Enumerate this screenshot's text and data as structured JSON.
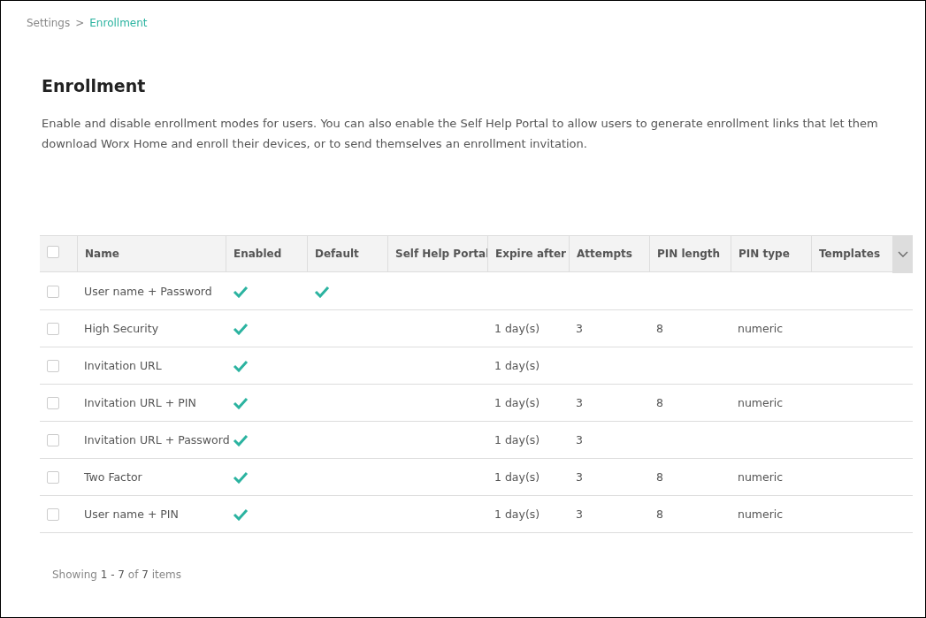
{
  "breadcrumb": [
    {
      "label": "Settings",
      "current": false
    },
    {
      "label": "Enrollment",
      "current": true
    }
  ],
  "breadcrumb_separator": ">",
  "title": "Enrollment",
  "description": "Enable and disable enrollment modes for users. You can also enable the Self Help Portal to allow users to generate enrollment links that let them download Worx Home and enroll their devices, or to send themselves an enrollment invitation.",
  "table": {
    "select_all": {
      "checked": false
    },
    "columns": [
      "Name",
      "Enabled",
      "Default",
      "Self Help Portal",
      "Expire after",
      "Attempts",
      "PIN length",
      "PIN type",
      "Templates"
    ],
    "rows": [
      {
        "selected": false,
        "name": "User name + Password",
        "enabled": true,
        "default": true
      },
      {
        "selected": false,
        "name": "High Security",
        "enabled": true,
        "default": false,
        "expire_after": "1 day(s)",
        "attempts": "3",
        "pin_length": "8",
        "pin_type": "numeric"
      },
      {
        "selected": false,
        "name": "Invitation URL",
        "enabled": true,
        "default": false,
        "expire_after": "1 day(s)"
      },
      {
        "selected": false,
        "name": "Invitation URL + PIN",
        "enabled": true,
        "default": false,
        "expire_after": "1 day(s)",
        "attempts": "3",
        "pin_length": "8",
        "pin_type": "numeric"
      },
      {
        "selected": false,
        "name": "Invitation URL + Password",
        "enabled": true,
        "default": false,
        "expire_after": "1 day(s)",
        "attempts": "3"
      },
      {
        "selected": false,
        "name": "Two Factor",
        "enabled": true,
        "default": false,
        "expire_after": "1 day(s)",
        "attempts": "3",
        "pin_length": "8",
        "pin_type": "numeric"
      },
      {
        "selected": false,
        "name": "User name + PIN",
        "enabled": true,
        "default": false,
        "expire_after": "1 day(s)",
        "attempts": "3",
        "pin_length": "8",
        "pin_type": "numeric"
      }
    ]
  },
  "footer": "Showing **1 - 7** of **7** items"
}
